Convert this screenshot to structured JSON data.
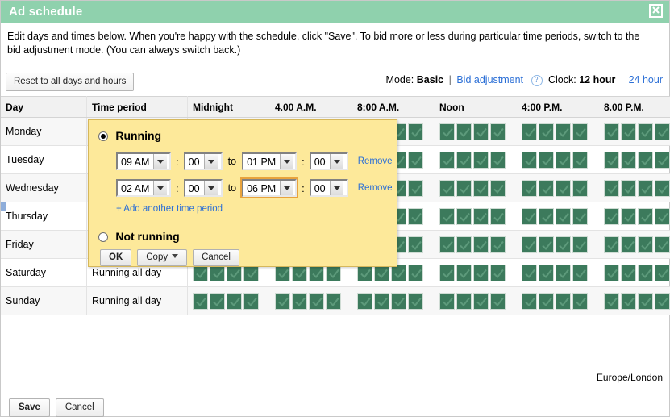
{
  "window": {
    "title": "Ad schedule",
    "close_label": "✕"
  },
  "intro": "Edit days and times below. When you're happy with the schedule, click \"Save\". To bid more or less during particular time periods, switch to the bid adjustment mode. (You can always switch back.)",
  "toolbar": {
    "reset_label": "Reset to all days and hours",
    "mode_label": "Mode:",
    "mode_current": "Basic",
    "mode_alt": "Bid adjustment",
    "help_icon_glyph": "?",
    "clock_label": "Clock:",
    "clock_current": "12 hour",
    "clock_alt": "24 hour",
    "separator": "|"
  },
  "table": {
    "headers": [
      "Day",
      "Time period",
      "Midnight",
      "4.00 A.M.",
      "8:00 A.M.",
      "Noon",
      "4:00 P.M.",
      "8.00 P.M."
    ],
    "rows": [
      {
        "day": "Monday",
        "period": "",
        "cells_per_block": 4
      },
      {
        "day": "Tuesday",
        "period": "",
        "cells_per_block": 4
      },
      {
        "day": "Wednesday",
        "period": "",
        "cells_per_block": 4
      },
      {
        "day": "Thursday",
        "period": "",
        "cells_per_block": 4
      },
      {
        "day": "Friday",
        "period": "",
        "cells_per_block": 4
      },
      {
        "day": "Saturday",
        "period": "Running all day",
        "cells_per_block": 4
      },
      {
        "day": "Sunday",
        "period": "Running all day",
        "cells_per_block": 4
      }
    ]
  },
  "popup": {
    "running_label": "Running",
    "running_selected": true,
    "not_running_label": "Not running",
    "not_running_selected": false,
    "time_periods": [
      {
        "start_hour": "09 AM",
        "start_minute": "00",
        "end_hour": "01 PM",
        "end_minute": "00",
        "to_label": "to",
        "colon": ":",
        "remove_label": "Remove",
        "focused_field": ""
      },
      {
        "start_hour": "02 AM",
        "start_minute": "00",
        "end_hour": "06 PM",
        "end_minute": "00",
        "to_label": "to",
        "colon": ":",
        "remove_label": "Remove",
        "focused_field": "end_hour"
      }
    ],
    "add_link": "+ Add another time period",
    "ok_label": "OK",
    "copy_label": "Copy",
    "cancel_label": "Cancel"
  },
  "footer": {
    "timezone": "Europe/London",
    "save_label": "Save",
    "cancel_label": "Cancel"
  },
  "colors": {
    "header_green": "#8fd1ad",
    "cell_green": "#3c7a5c",
    "popup_yellow": "#fde99a",
    "link_blue": "#2b6fd6",
    "focus_orange": "#e8a33d"
  }
}
